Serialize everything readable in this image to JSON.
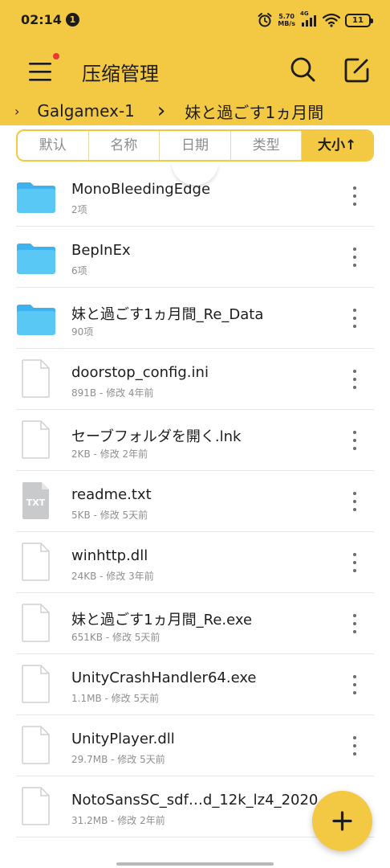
{
  "status_bar": {
    "time": "02:14",
    "notification_badge": "1",
    "network_speed_value": "5.70",
    "network_speed_unit": "MB/s",
    "network_type": "4G",
    "battery_level": "11"
  },
  "toolbar": {
    "title": "压缩管理"
  },
  "breadcrumb": {
    "items": [
      "Galgamex-1",
      "妹と過ごす1ヵ月間"
    ]
  },
  "sort_tabs": [
    {
      "label": "默认",
      "active": false
    },
    {
      "label": "名称",
      "active": false
    },
    {
      "label": "日期",
      "active": false
    },
    {
      "label": "类型",
      "active": false
    },
    {
      "label": "大小↑",
      "active": true
    }
  ],
  "files": [
    {
      "name": "MonoBleedingEdge",
      "meta": "2项",
      "kind": "folder-icon"
    },
    {
      "name": "BepInEx",
      "meta": "6项",
      "kind": "folder-icon"
    },
    {
      "name": "妹と過ごす1ヵ月間_Re_Data",
      "meta": "90项",
      "kind": "folder-icon"
    },
    {
      "name": "doorstop_config.ini",
      "meta": "891B - 修改 4年前",
      "kind": "file-icon"
    },
    {
      "name": "セーブフォルダを開く.lnk",
      "meta": "2KB - 修改 2年前",
      "kind": "file-icon"
    },
    {
      "name": "readme.txt",
      "meta": "5KB - 修改 5天前",
      "kind": "txt-file-icon",
      "icon_label": "TXT"
    },
    {
      "name": "winhttp.dll",
      "meta": "24KB - 修改 3年前",
      "kind": "file-icon"
    },
    {
      "name": "妹と過ごす1ヵ月間_Re.exe",
      "meta": "651KB - 修改 5天前",
      "kind": "file-icon"
    },
    {
      "name": "UnityCrashHandler64.exe",
      "meta": "1.1MB - 修改 5天前",
      "kind": "file-icon"
    },
    {
      "name": "UnityPlayer.dll",
      "meta": "29.7MB - 修改 5天前",
      "kind": "file-icon"
    },
    {
      "name": "NotoSansSC_sdf…d_12k_lz4_2020",
      "meta": "31.2MB - 修改 2年前",
      "kind": "file-icon"
    }
  ],
  "colors": {
    "accent": "#F3C842",
    "folder": "#5AC8F5",
    "folder_tab": "#3DB2EE",
    "txt_icon": "#C9CACC",
    "divider": "#E6E6E6"
  }
}
